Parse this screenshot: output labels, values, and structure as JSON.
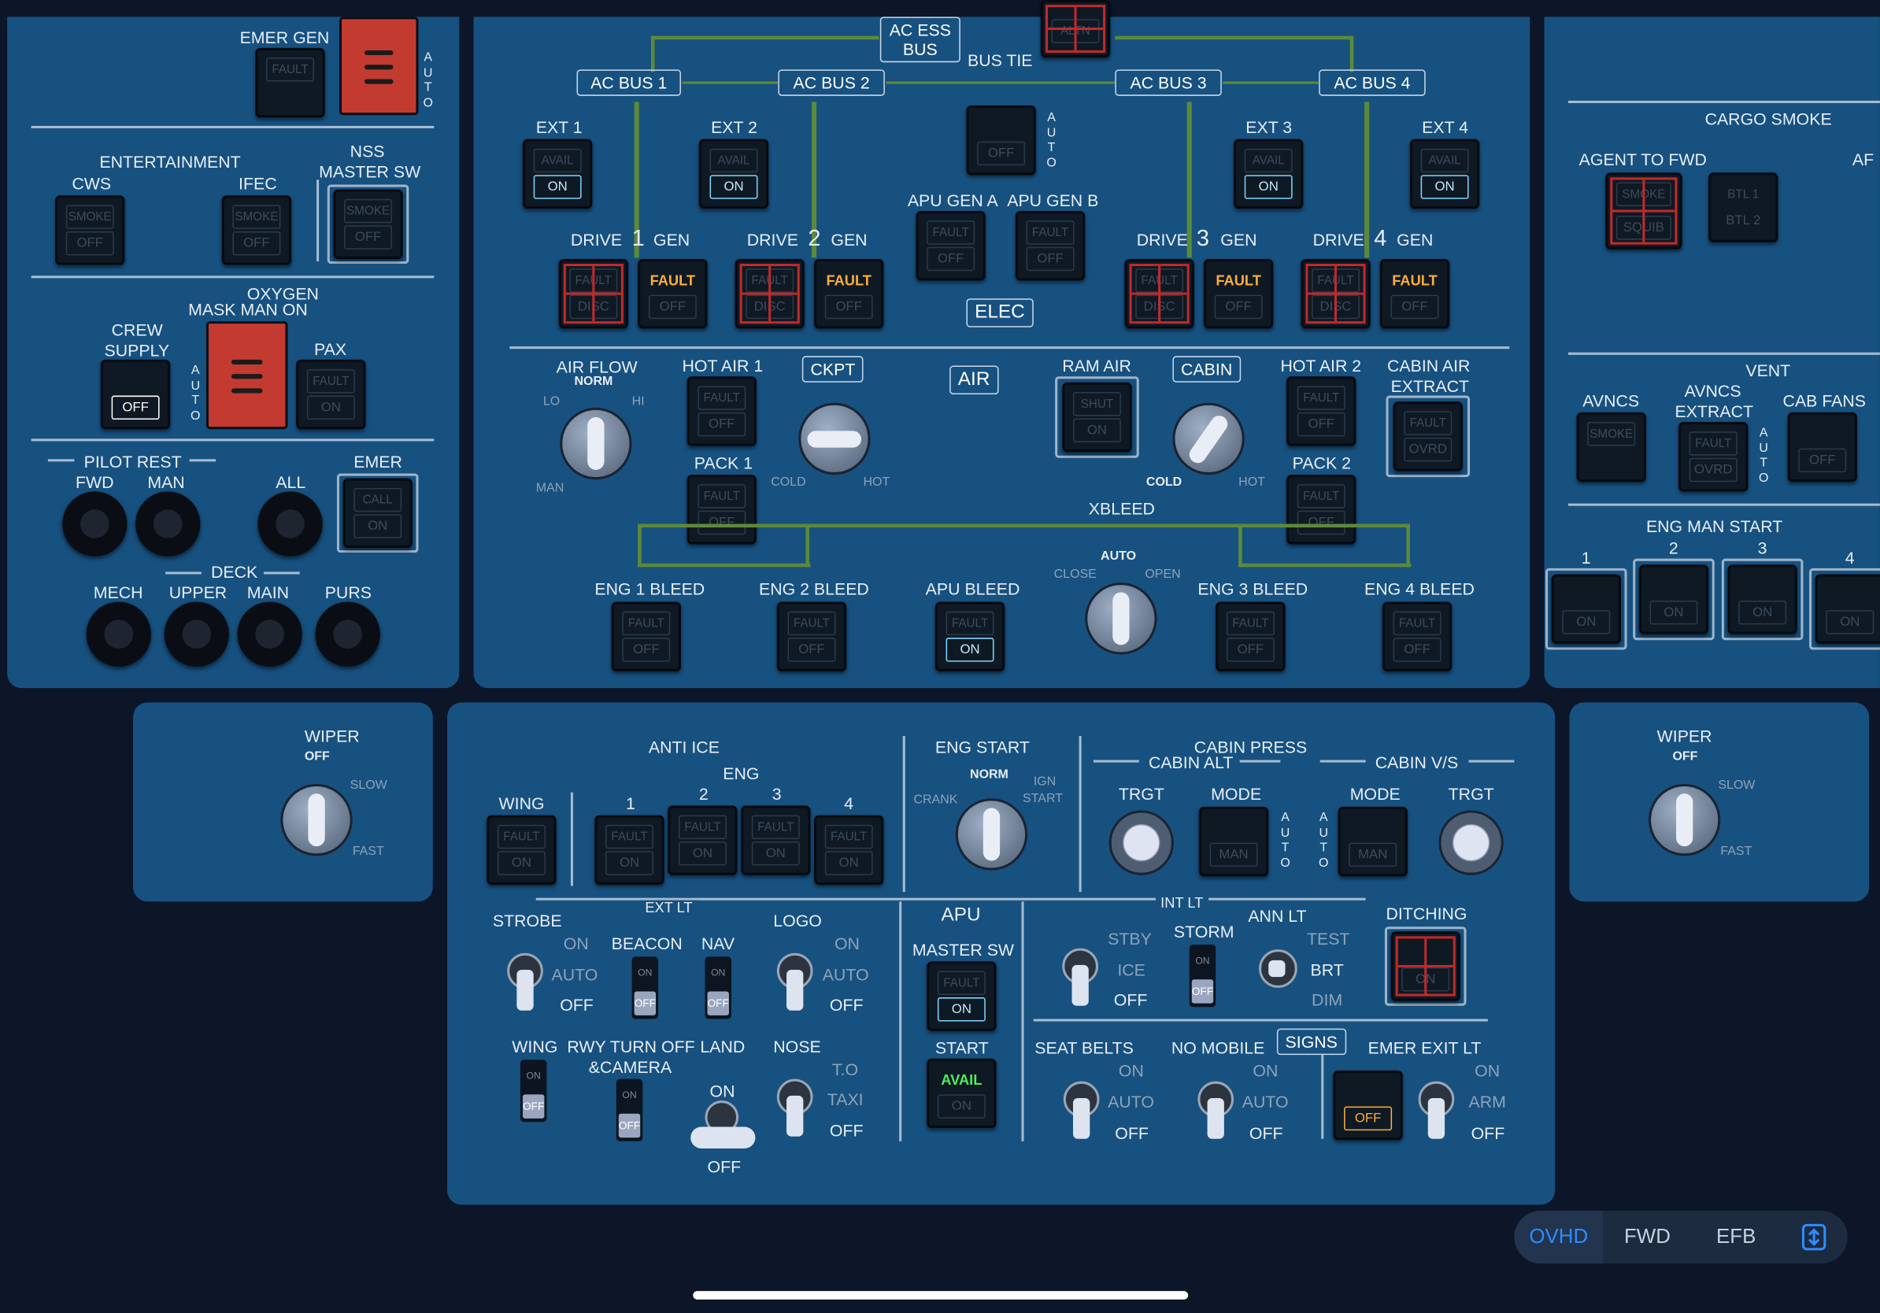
{
  "left": {
    "emer_gen": "EMER GEN",
    "fault": "FAULT",
    "auto": "A U T O",
    "entertainment": "ENTERTAINMENT",
    "cws": "CWS",
    "ifec": "IFEC",
    "nss": "NSS",
    "master_sw": "MASTER SW",
    "smoke": "SMOKE",
    "off": "OFF",
    "oxygen": "OXYGEN",
    "mask_man_on": "MASK MAN ON",
    "crew": "CREW",
    "supply": "SUPPLY",
    "pax": "PAX",
    "on": "ON",
    "pilot_rest": "PILOT REST",
    "fwd": "FWD",
    "man": "MAN",
    "all": "ALL",
    "emer": "EMER",
    "call": "CALL",
    "deck": "DECK",
    "mech": "MECH",
    "upper": "UPPER",
    "main": "MAIN",
    "purs": "PURS"
  },
  "elec": {
    "ac_ess_bus": "AC ESS BUS",
    "bus_tie": "BUS TIE",
    "ac_bus_1": "AC BUS 1",
    "ac_bus_2": "AC BUS 2",
    "ac_bus_3": "AC BUS 3",
    "ac_bus_4": "AC BUS 4",
    "ext1": "EXT 1",
    "ext2": "EXT 2",
    "ext3": "EXT 3",
    "ext4": "EXT 4",
    "avail": "AVAIL",
    "on": "ON",
    "off": "OFF",
    "auto": "A U T O",
    "altn": "ALTN",
    "apu_gen_a": "APU GEN A",
    "apu_gen_b": "APU GEN B",
    "fault": "FAULT",
    "drive": "DRIVE",
    "gen": "GEN",
    "n1": "1",
    "n2": "2",
    "n3": "3",
    "n4": "4",
    "disc": "DISC",
    "elec": "ELEC"
  },
  "air": {
    "air_flow": "AIR FLOW",
    "norm": "NORM",
    "lo": "LO",
    "hi": "HI",
    "man": "MAN",
    "hot_air_1": "HOT AIR 1",
    "ckpt": "CKPT",
    "air": "AIR",
    "ram_air": "RAM AIR",
    "cabin": "CABIN",
    "hot_air_2": "HOT AIR 2",
    "cabin_air": "CABIN AIR",
    "extract": "EXTRACT",
    "fault": "FAULT",
    "off": "OFF",
    "on": "ON",
    "shut": "SHUT",
    "ovrd": "OVRD",
    "cold": "COLD",
    "hot": "HOT",
    "pack1": "PACK 1",
    "pack2": "PACK 2",
    "xbleed": "XBLEED",
    "auto": "AUTO",
    "close": "CLOSE",
    "open": "OPEN",
    "eng1_bleed": "ENG 1 BLEED",
    "eng2_bleed": "ENG 2 BLEED",
    "apu_bleed": "APU BLEED",
    "eng3_bleed": "ENG 3 BLEED",
    "eng4_bleed": "ENG 4 BLEED"
  },
  "right": {
    "cargo_smoke": "CARGO SMOKE",
    "agent_to_fwd": "AGENT TO FWD",
    "af": "AF",
    "smoke": "SMOKE",
    "squib": "SQUIB",
    "btl1": "BTL 1",
    "btl2": "BTL 2",
    "vent": "VENT",
    "avncs": "AVNCS",
    "avncs_extract": "AVNCS",
    "extract": "EXTRACT",
    "cab_fans": "CAB FANS",
    "fault": "FAULT",
    "ovrd": "OVRD",
    "off": "OFF",
    "auto": "A U T O",
    "eng_man_start": "ENG MAN START",
    "n1": "1",
    "n2": "2",
    "n3": "3",
    "n4": "4",
    "on": "ON"
  },
  "wiper": {
    "wiper": "WIPER",
    "off": "OFF",
    "slow": "SLOW",
    "fast": "FAST"
  },
  "lower": {
    "anti_ice": "ANTI ICE",
    "eng": "ENG",
    "wing": "WING",
    "e1": "1",
    "e2": "2",
    "e3": "3",
    "e4": "4",
    "fault": "FAULT",
    "on": "ON",
    "eng_start": "ENG START",
    "norm": "NORM",
    "crank": "CRANK",
    "ign": "IGN",
    "start": "START",
    "cabin_press": "CABIN PRESS",
    "cabin_alt": "CABIN ALT",
    "cabin_vs": "CABIN V/S",
    "trgt": "TRGT",
    "mode": "MODE",
    "man": "MAN",
    "auto": "A U T O",
    "ext_lt": "EXT LT",
    "strobe": "STROBE",
    "beacon": "BEACON",
    "nav": "NAV",
    "logo": "LOGO",
    "auto_w": "AUTO",
    "off": "OFF",
    "apu": "APU",
    "master_sw": "MASTER SW",
    "start_lbl": "START",
    "avail": "AVAIL",
    "int_lt": "INT LT",
    "stby": "STBY",
    "ice": "ICE",
    "storm": "STORM",
    "ann_lt": "ANN LT",
    "test": "TEST",
    "brt": "BRT",
    "dim": "DIM",
    "ditching": "DITCHING",
    "wing_lt": "WING",
    "rwy_turn_off": "RWY TURN OFF",
    "camera": "&CAMERA",
    "land": "LAND",
    "nose": "NOSE",
    "to": "T.O",
    "taxi": "TAXI",
    "seat_belts": "SEAT BELTS",
    "no_mobile": "NO MOBILE",
    "signs": "SIGNS",
    "emer_exit_lt": "EMER EXIT LT",
    "arm": "ARM"
  },
  "tabs": {
    "ovhd": "OVHD",
    "fwd": "FWD",
    "efb": "EFB"
  },
  "colors": {
    "panel": "#175180",
    "background": "#0c1628",
    "fault_amber": "#ffad3b",
    "avail_green": "#4bf05a",
    "guard_red": "#c02a2a",
    "active_tab": "#2f8cff"
  }
}
